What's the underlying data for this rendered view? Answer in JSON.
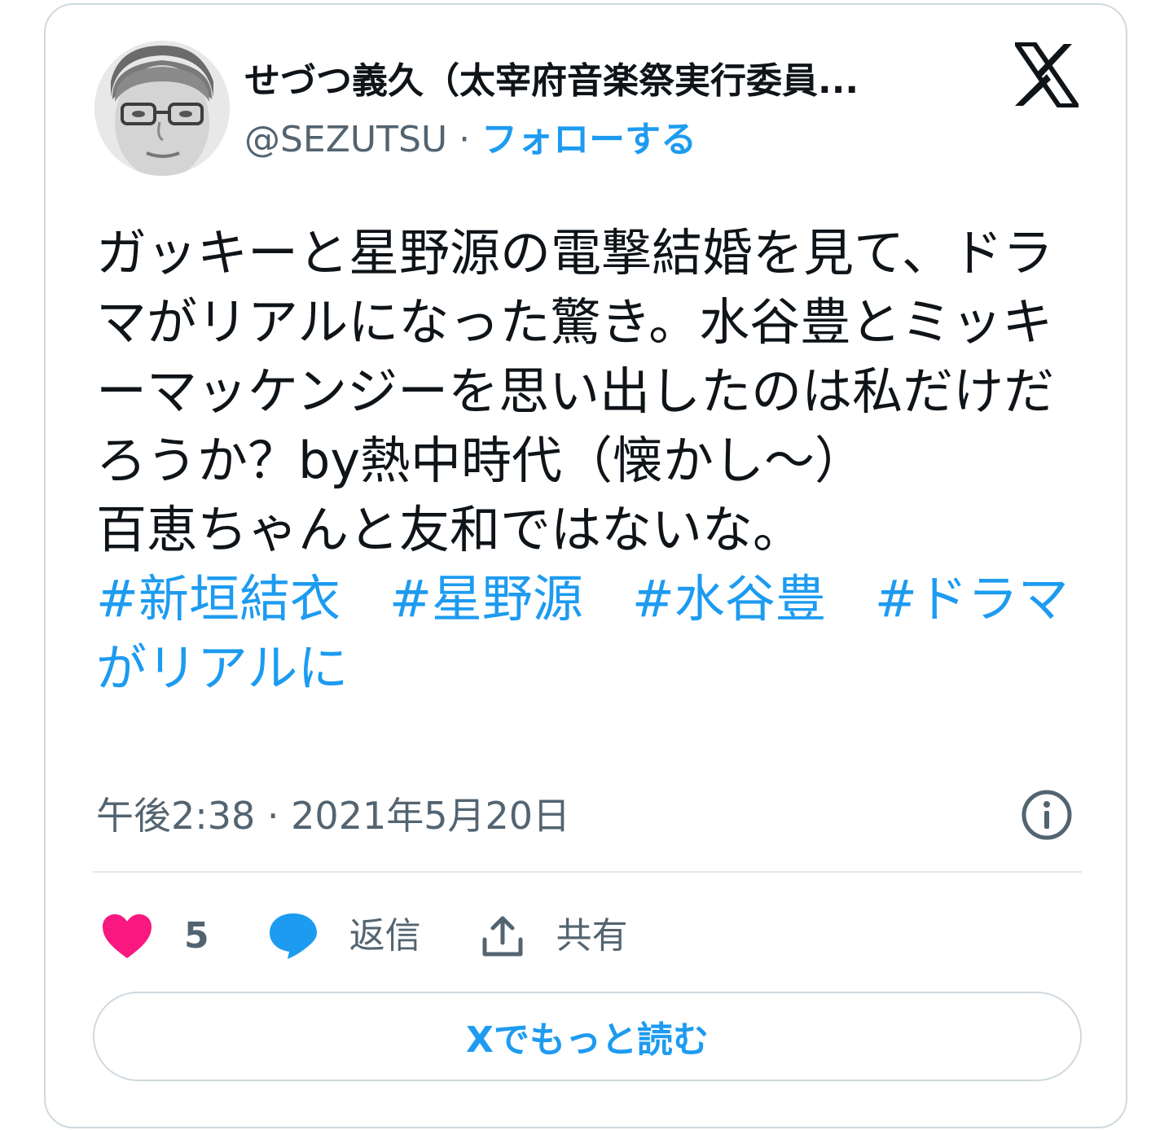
{
  "tweet": {
    "author_name": "せづつ義久（太宰府音楽祭実行委員...",
    "handle": "@SEZUTSU",
    "separator": "·",
    "follow_label": "フォローする",
    "text_lines": [
      "ガッキーと星野源の電撃結婚を見て、ドラマがリアルになった驚き。水谷豊とミッキーマッケンジーを思い出したのは私だけだろうか？by熱中時代（懐かし〜）",
      "百恵ちゃんと友和ではないな。"
    ],
    "hashtags": [
      "#新垣結衣",
      "#星野源",
      "#水谷豊",
      "#ドラマがリアルに"
    ],
    "timestamp": "午後2:38 · 2021年5月20日"
  },
  "actions": {
    "like_count": "5",
    "reply_label": "返信",
    "share_label": "共有"
  },
  "read_more_label": "Xでもっと読む",
  "colors": {
    "accent": "#1d9bf0",
    "like": "#f91880",
    "text_primary": "#0f1419",
    "text_secondary": "#536471",
    "border": "#cfd9de"
  },
  "icons": {
    "brand": "x-logo-icon",
    "info": "info-icon",
    "like": "heart-icon",
    "reply": "speech-bubble-icon",
    "share": "share-upload-icon"
  }
}
